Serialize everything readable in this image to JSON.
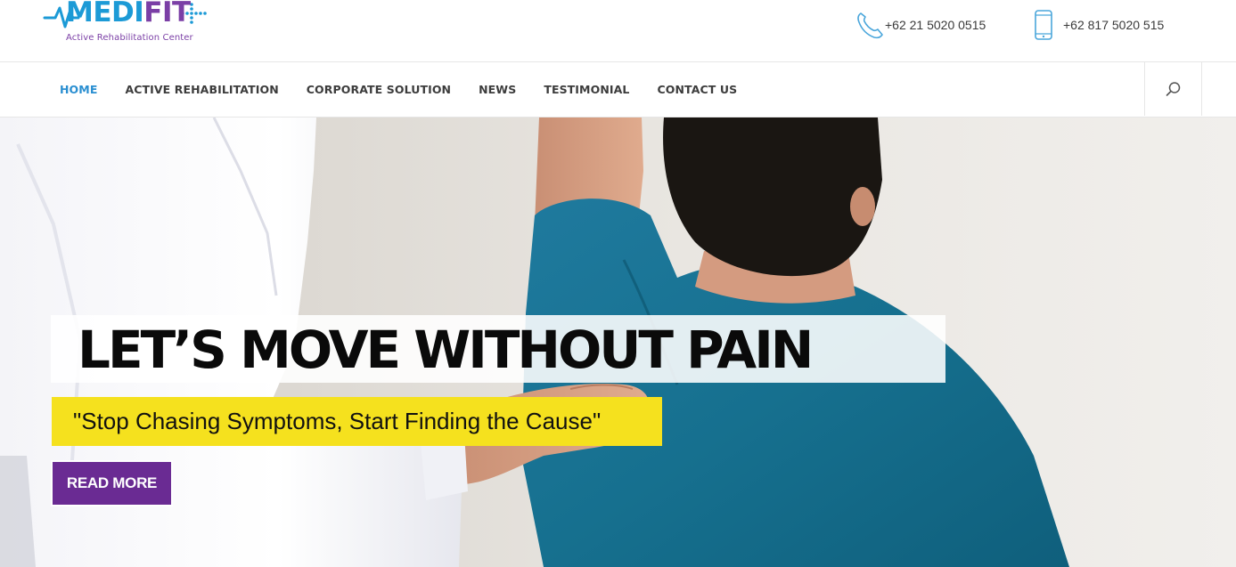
{
  "brand": {
    "name_part1": "MEDI",
    "name_part2": "FIT",
    "tagline": "Active Rehabilitation Center",
    "colors": {
      "blue": "#1c9ad6",
      "purple": "#7b3fa6"
    }
  },
  "header": {
    "contacts": [
      {
        "icon": "phone-icon",
        "number": "+62 21 5020 0515"
      },
      {
        "icon": "mobile-phone-icon",
        "number": "+62 817 5020 515"
      }
    ]
  },
  "nav": {
    "items": [
      {
        "label": "HOME",
        "active": true
      },
      {
        "label": "ACTIVE REHABILITATION",
        "active": false
      },
      {
        "label": "CORPORATE SOLUTION",
        "active": false
      },
      {
        "label": "NEWS",
        "active": false
      },
      {
        "label": "TESTIMONIAL",
        "active": false
      },
      {
        "label": "CONTACT US",
        "active": false
      }
    ],
    "search_icon": "search-icon",
    "active_color": "#2a8fd1"
  },
  "hero": {
    "headline": "LET’S MOVE WITHOUT PAIN",
    "subheadline": "\"Stop Chasing Symptoms, Start Finding the Cause\"",
    "button_label": "READ MORE",
    "colors": {
      "subheadline_bg": "#f5e11e",
      "button_bg": "#6a2b93"
    }
  }
}
